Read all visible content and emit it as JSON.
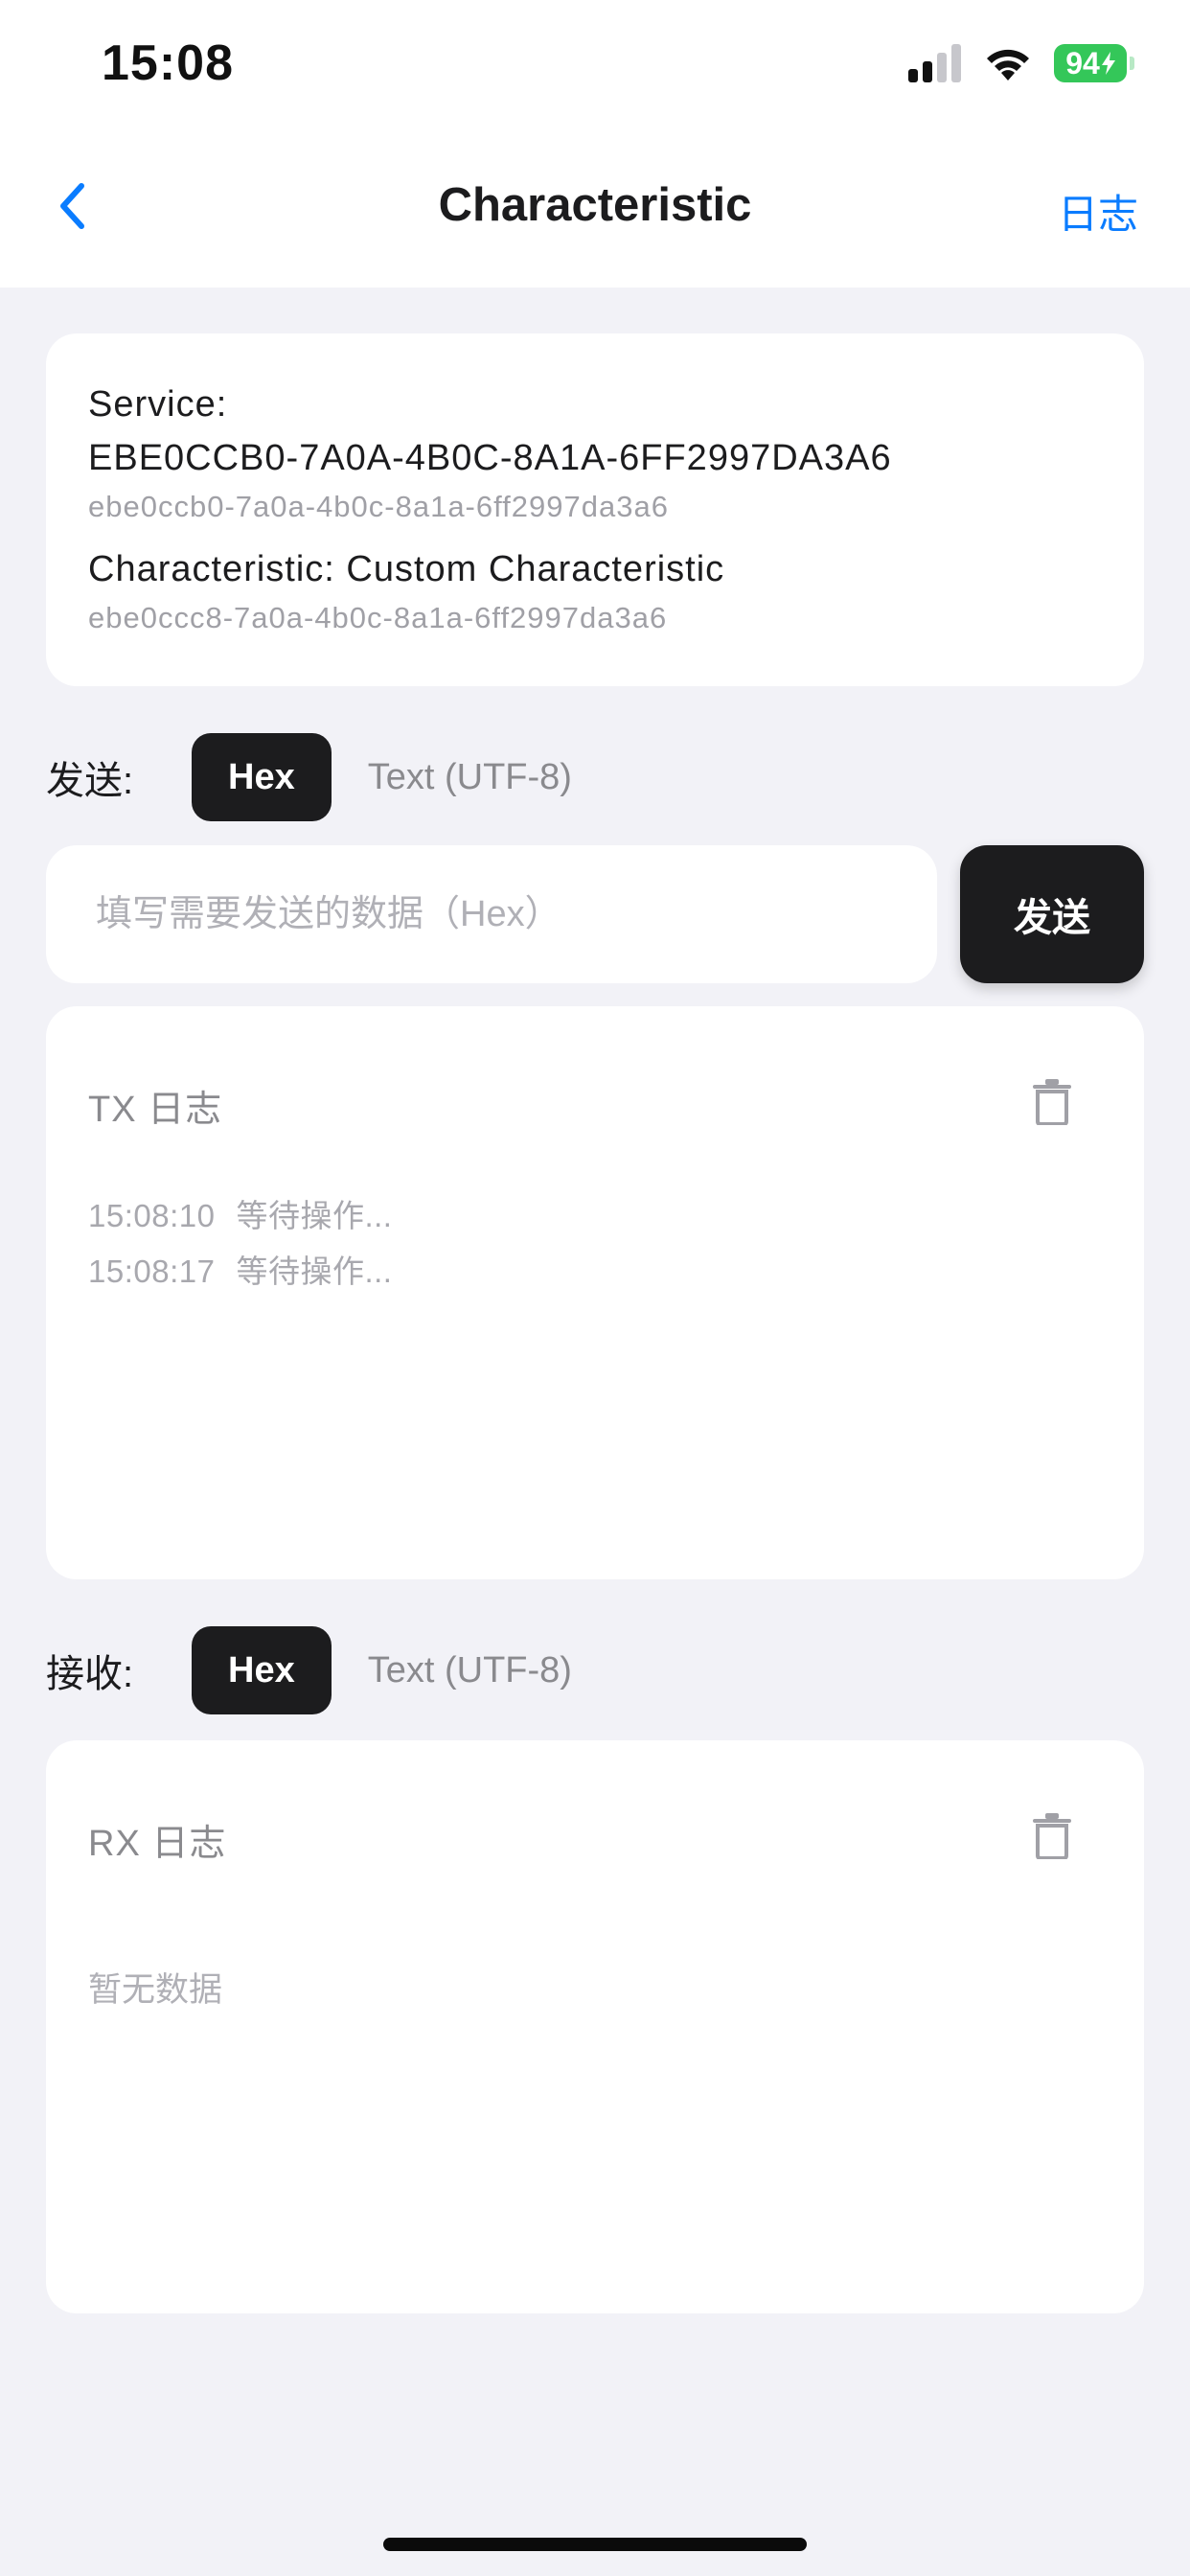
{
  "status": {
    "time": "15:08",
    "battery": "94"
  },
  "nav": {
    "title": "Characteristic",
    "log_label": "日志"
  },
  "info": {
    "service_label": "Service:",
    "service_uuid": "EBE0CCB0-7A0A-4B0C-8A1A-6FF2997DA3A6",
    "service_uuid_lower": "ebe0ccb0-7a0a-4b0c-8a1a-6ff2997da3a6",
    "characteristic_label": "Characteristic: Custom Characteristic",
    "characteristic_uuid_lower": "ebe0ccc8-7a0a-4b0c-8a1a-6ff2997da3a6"
  },
  "send": {
    "label": "发送:",
    "modes": [
      "Hex",
      "Text (UTF-8)"
    ],
    "placeholder": "填写需要发送的数据（Hex）",
    "button": "发送"
  },
  "tx_log": {
    "title": "TX 日志",
    "entries": [
      {
        "time": "15:08:10",
        "message": "等待操作..."
      },
      {
        "time": "15:08:17",
        "message": "等待操作..."
      }
    ]
  },
  "receive": {
    "label": "接收:",
    "modes": [
      "Hex",
      "Text (UTF-8)"
    ]
  },
  "rx_log": {
    "title": "RX 日志",
    "empty_text": "暂无数据"
  },
  "colors": {
    "accent": "#0a7cff",
    "dark": "#1c1c1e",
    "battery": "#34c759",
    "background": "#f2f2f7"
  }
}
